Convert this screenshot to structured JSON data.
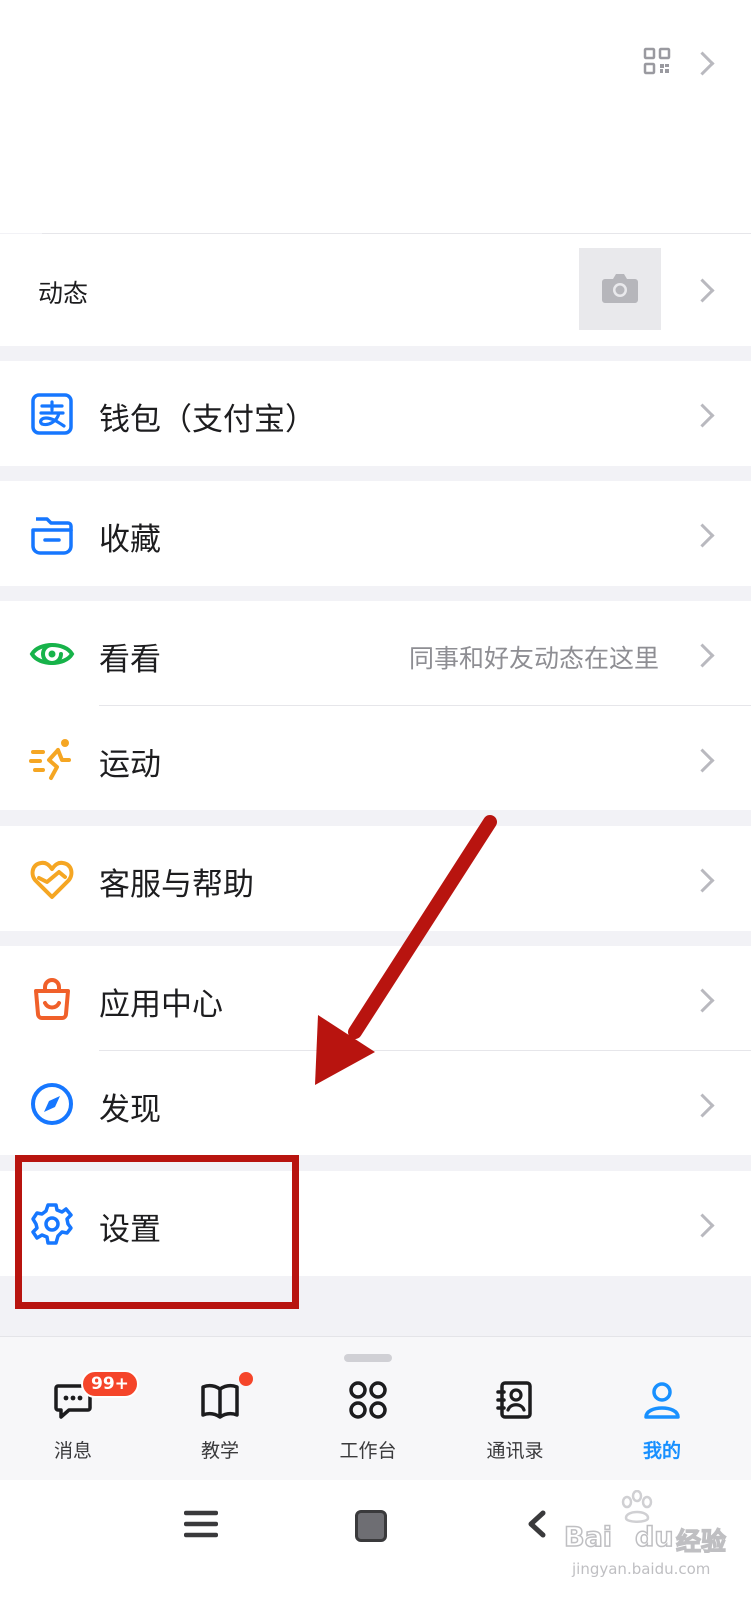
{
  "profile": {
    "qr_icon": "qr-code-icon"
  },
  "moments": {
    "label": "动态",
    "photo_icon": "camera-icon"
  },
  "menu": {
    "wallet": "钱包（支付宝）",
    "favorites": "收藏",
    "kankan": "看看",
    "kankan_hint": "同事和好友动态在这里",
    "sports": "运动",
    "help": "客服与帮助",
    "app_center": "应用中心",
    "discover": "发现",
    "settings": "设置"
  },
  "tabbar": {
    "messages": "消息",
    "messages_badge": "99+",
    "teaching": "教学",
    "workbench": "工作台",
    "contacts": "通讯录",
    "me": "我的"
  },
  "watermark": {
    "brand": "Bai",
    "brand2": "du",
    "jingyan": "经验",
    "url": "jingyan.baidu.com"
  },
  "colors": {
    "accent": "#1890ff",
    "badge": "#f5452a",
    "annotation": "#b8140f"
  }
}
